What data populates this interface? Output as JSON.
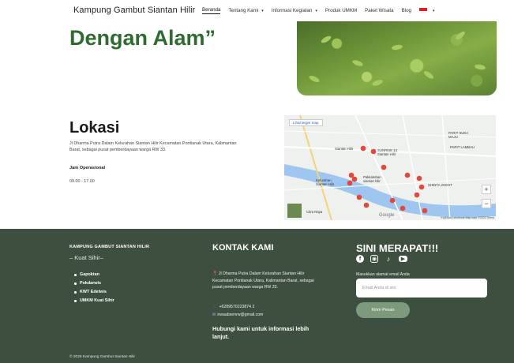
{
  "navbar": {
    "brand": "Kampung Gambut Siantan Hilir",
    "items": [
      {
        "label": "Beranda",
        "active": true,
        "dropdown": false
      },
      {
        "label": "Tentang Kami",
        "active": false,
        "dropdown": true
      },
      {
        "label": "Informasi Kegiatan",
        "active": false,
        "dropdown": true
      },
      {
        "label": "Produk UMKM",
        "active": false,
        "dropdown": false
      },
      {
        "label": "Paket Wisata",
        "active": false,
        "dropdown": false
      },
      {
        "label": "Blog",
        "active": false,
        "dropdown": false
      }
    ],
    "language": {
      "caret": "▾"
    }
  },
  "hero": {
    "line1": "Dengan Alam”",
    "image_colors": {
      "dark": "#4a6e2a",
      "light": "#a8cb5f"
    }
  },
  "lokasi": {
    "title": "Lokasi",
    "address": "Jl Dharma Putra Dalam Kelurahan Siantan Hilir Kecamatan Pontianak Utara, Kalimantan Barat, sebagai pusat pemberdayaan warga RW 33.",
    "jam_label": "Jam Operasional",
    "jam_value": "09.00 - 17.00"
  },
  "map": {
    "view_larger": "Lihat larger map",
    "zoom_in": "+",
    "zoom_out": "−",
    "logo": "Google",
    "footer": "Keyboard shortcuts   Map data ©2023   Terms",
    "labels": {
      "siantan_hilir": "Siantan Hilir",
      "sunrise": "SUNRISE 13\nSiantan Hilir",
      "kelurahan": "Kelurahan\nSiantan Hilir",
      "pakkateban": "Pakkateban\nsiantan hilir",
      "parit": "PARIT SUKA\nMAJU",
      "parit2": "PARIT LAMBAU",
      "shinta": "SHINTA JOGST",
      "citra": "Citra Raya"
    }
  },
  "footer": {
    "brand": "KAMPUNG GAMBUT SIANTAN HILIR",
    "tagline": "– Kuat Sihir–",
    "links": [
      "Gapoktan",
      "Pokdarwis",
      "KWT Edelwis",
      "UMKM Kuat Sihir"
    ],
    "kontak_title": "KONTAK KAMI",
    "kontak_address": "Jl Dharma Putra Dalam Kelurahan Siantan Hilir Kecamatan Pontianak Utara, Kalimantan Barat, sebagai pusat pemberdayaan warga RW 33.",
    "phone": "+6289570223874 2",
    "email": "irwaabsenrw@gmail.com",
    "help_text": "Hubungi kami untuk informasi lebih lanjut.",
    "subscribe_title": "SINI MERAPAT!!!",
    "subscribe_label": "Masukkan alamat email Anda",
    "subscribe_placeholder": "Email Anda di sini",
    "subscribe_button": "Kirim Pesan",
    "copyright": "© 2025 Kampung Gambut Siantan Hilir",
    "bg_color": "#3d4f3e",
    "accent_button": "#7e9a7c"
  },
  "social": [
    "facebook-icon",
    "instagram-icon",
    "tiktok-icon",
    "youtube-icon"
  ]
}
